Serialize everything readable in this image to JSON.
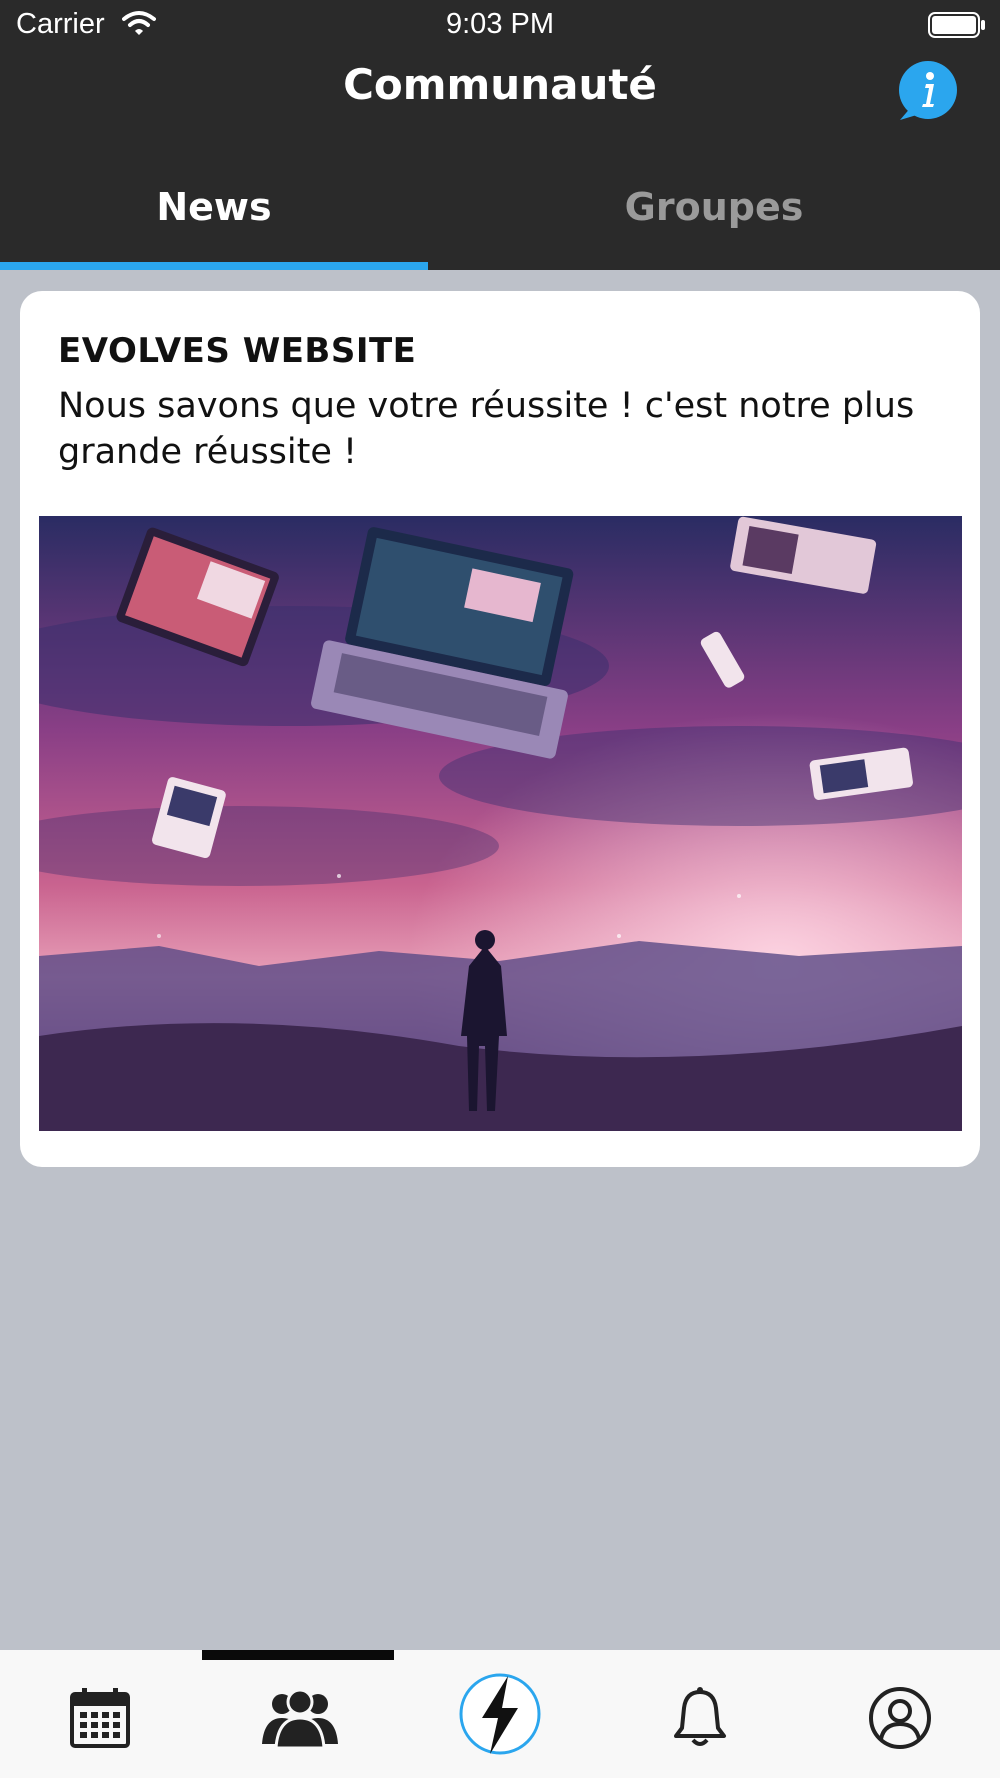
{
  "status_bar": {
    "carrier": "Carrier",
    "time": "9:03 PM"
  },
  "header": {
    "title": "Communauté"
  },
  "tabs": [
    {
      "label": "News",
      "active": true
    },
    {
      "label": "Groupes",
      "active": false
    }
  ],
  "post": {
    "author": "EVOLVES WEBSITE",
    "text": "Nous savons que votre réussite ! c'est notre plus grande réussite !"
  },
  "bottom_nav": {
    "items": [
      {
        "icon": "calendar-icon"
      },
      {
        "icon": "community-icon",
        "active": true
      },
      {
        "icon": "lightning-icon"
      },
      {
        "icon": "bell-icon"
      },
      {
        "icon": "profile-icon"
      }
    ]
  },
  "colors": {
    "header_bg": "#2a2a2a",
    "accent": "#2ba6ee",
    "background": "#bdc1c9",
    "card": "#ffffff"
  }
}
